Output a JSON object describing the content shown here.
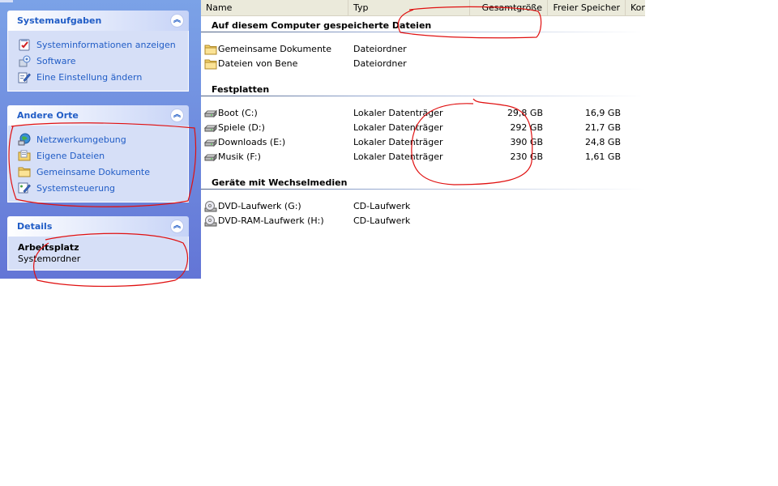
{
  "taskpane": {
    "system_tasks": {
      "title": "Systemaufgaben",
      "items": [
        {
          "label": "Systeminformationen anzeigen",
          "icon": "system-info-icon"
        },
        {
          "label": "Software",
          "icon": "software-icon"
        },
        {
          "label": "Eine Einstellung ändern",
          "icon": "change-setting-icon"
        }
      ]
    },
    "other_places": {
      "title": "Andere Orte",
      "items": [
        {
          "label": "Netzwerkumgebung",
          "icon": "network-icon"
        },
        {
          "label": "Eigene Dateien",
          "icon": "my-documents-icon"
        },
        {
          "label": "Gemeinsame Dokumente",
          "icon": "folder-icon"
        },
        {
          "label": "Systemsteuerung",
          "icon": "control-panel-icon"
        }
      ]
    },
    "details": {
      "title": "Details",
      "name": "Arbeitsplatz",
      "type": "Systemordner"
    }
  },
  "listview": {
    "columns": {
      "name": "Name",
      "type": "Typ",
      "total": "Gesamtgröße",
      "free": "Freier Speicher",
      "comment": "Kor"
    },
    "groups": [
      {
        "title": "Auf diesem Computer gespeicherte Dateien",
        "rows": [
          {
            "name": "Gemeinsame Dokumente",
            "type": "Dateiordner",
            "total": "",
            "free": "",
            "icon": "folder-icon"
          },
          {
            "name": "Dateien von Bene",
            "type": "Dateiordner",
            "total": "",
            "free": "",
            "icon": "folder-icon"
          }
        ]
      },
      {
        "title": "Festplatten",
        "rows": [
          {
            "name": "Boot (C:)",
            "type": "Lokaler Datenträger",
            "total": "29,8 GB",
            "free": "16,9 GB",
            "icon": "hard-drive-icon"
          },
          {
            "name": "Spiele (D:)",
            "type": "Lokaler Datenträger",
            "total": "292 GB",
            "free": "21,7 GB",
            "icon": "hard-drive-icon"
          },
          {
            "name": "Downloads (E:)",
            "type": "Lokaler Datenträger",
            "total": "390 GB",
            "free": "24,8 GB",
            "icon": "hard-drive-icon"
          },
          {
            "name": "Musik (F:)",
            "type": "Lokaler Datenträger",
            "total": "230 GB",
            "free": "1,61 GB",
            "icon": "hard-drive-icon"
          }
        ]
      },
      {
        "title": "Geräte mit Wechselmedien",
        "rows": [
          {
            "name": "DVD-Laufwerk (G:)",
            "type": "CD-Laufwerk",
            "total": "",
            "free": "",
            "icon": "dvd-drive-icon"
          },
          {
            "name": "DVD-RAM-Laufwerk (H:)",
            "type": "CD-Laufwerk",
            "total": "",
            "free": "",
            "icon": "dvd-drive-icon"
          }
        ]
      }
    ]
  },
  "colors": {
    "taskpane_gradient_top": "#7ba2e7",
    "taskpane_gradient_bottom": "#6375d6",
    "panel_body": "#d6dff7",
    "link_blue": "#215dc6",
    "annotation_red": "#e01010",
    "column_header": "#ebeadb"
  }
}
